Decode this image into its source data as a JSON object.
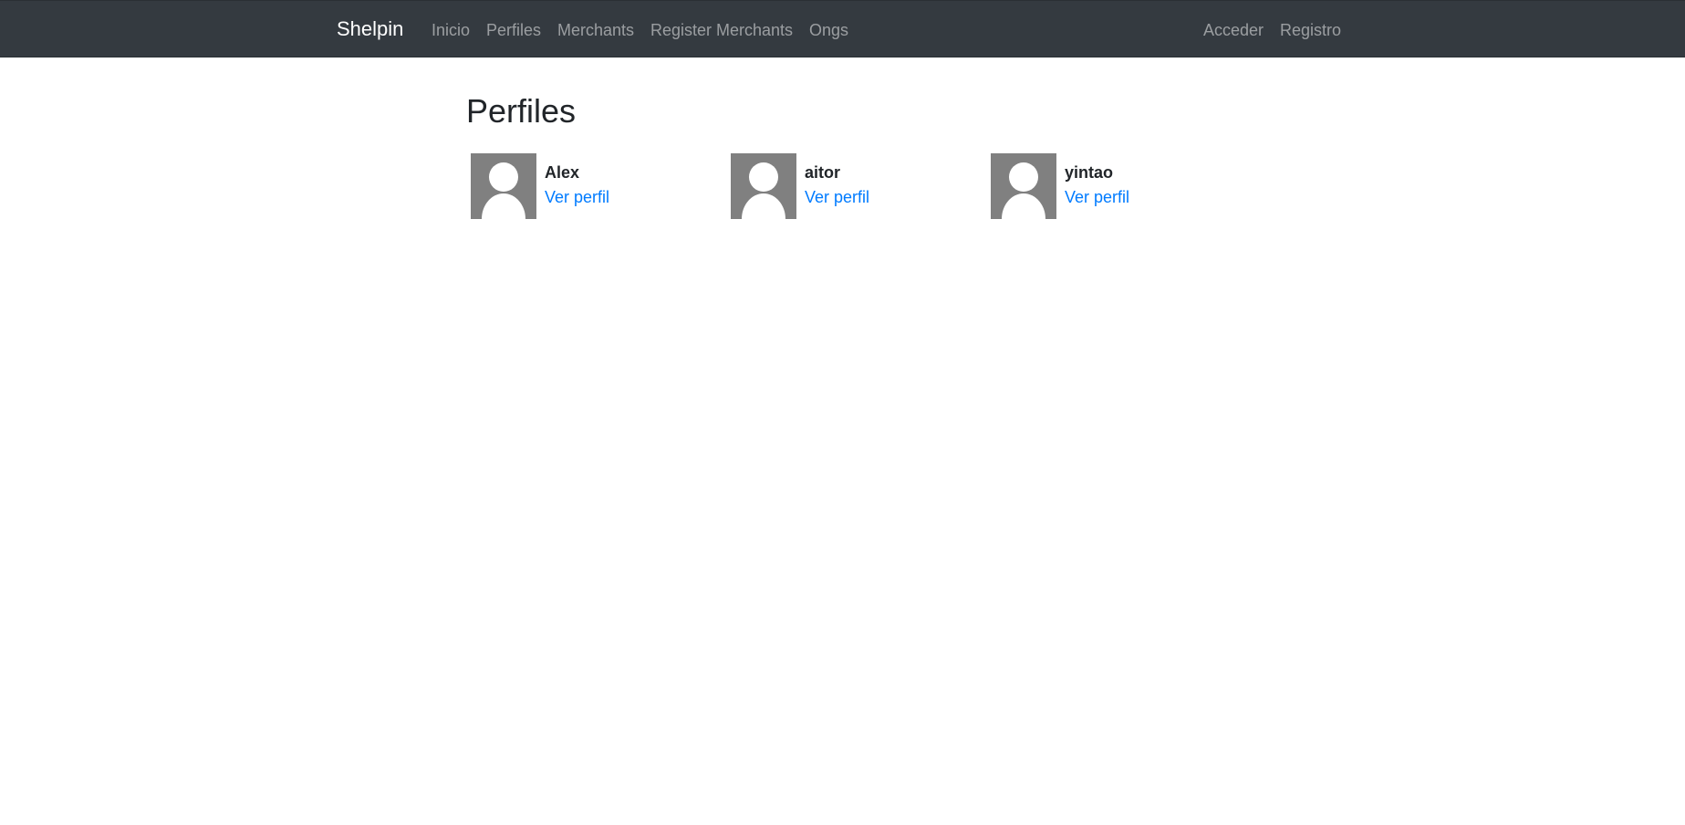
{
  "navbar": {
    "brand": "Shelpin",
    "left_links": [
      {
        "label": "Inicio"
      },
      {
        "label": "Perfiles"
      },
      {
        "label": "Merchants"
      },
      {
        "label": "Register Merchants"
      },
      {
        "label": "Ongs"
      }
    ],
    "right_links": [
      {
        "label": "Acceder"
      },
      {
        "label": "Registro"
      }
    ],
    "background_color": "#343a40",
    "link_color": "rgba(255,255,255,0.5)"
  },
  "main": {
    "title": "Perfiles",
    "profiles": [
      {
        "name": "Alex",
        "link_label": "Ver perfil",
        "avatar_icon": "user-silhouette-icon"
      },
      {
        "name": "aitor",
        "link_label": "Ver perfil",
        "avatar_icon": "user-silhouette-icon"
      },
      {
        "name": "yintao",
        "link_label": "Ver perfil",
        "avatar_icon": "user-silhouette-icon"
      }
    ],
    "link_color": "#007bff"
  }
}
